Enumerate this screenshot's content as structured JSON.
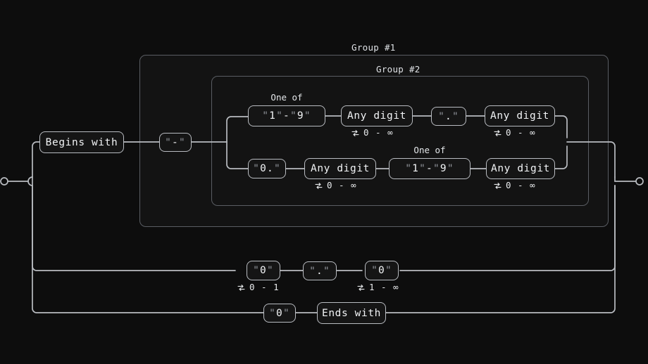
{
  "diagram": {
    "type": "regex-railroad",
    "background": "#0d0d0d",
    "line_color": "#b9bcc1",
    "node_border": "#b9bcc1",
    "group_border": "#5a5d63",
    "text_color": "#f2f4f6"
  },
  "groups": [
    {
      "id": "group1",
      "label": "Group #1"
    },
    {
      "id": "group2",
      "label": "Group #2"
    }
  ],
  "nodes": {
    "begins_with": {
      "label": "Begins with"
    },
    "dash": {
      "label": "\"-\""
    },
    "one_of_1_9_top": {
      "label": "\"1\" - \"9\"",
      "caption": "One of"
    },
    "any_digit_top_1": {
      "label": "Any digit",
      "quantifier": "0 - ∞"
    },
    "dot_top": {
      "label": "\".\""
    },
    "any_digit_top_2": {
      "label": "Any digit",
      "quantifier": "0 - ∞"
    },
    "zero_dot": {
      "label": "\"0.\""
    },
    "any_digit_bot_1": {
      "label": "Any digit",
      "quantifier": "0 - ∞"
    },
    "one_of_1_9_bot": {
      "label": "\"1\" - \"9\"",
      "caption": "One of"
    },
    "any_digit_bot_2": {
      "label": "Any digit",
      "quantifier": "0 - ∞"
    },
    "zero_a": {
      "label": "\"0\"",
      "quantifier": "0 - 1"
    },
    "dot_row3": {
      "label": "\".\""
    },
    "zero_b": {
      "label": "\"0\"",
      "quantifier": "1 - ∞"
    },
    "zero_c": {
      "label": "\"0\""
    },
    "ends_with": {
      "label": "Ends with"
    }
  },
  "terminals": {
    "start": "start-circle",
    "end": "end-circle"
  }
}
